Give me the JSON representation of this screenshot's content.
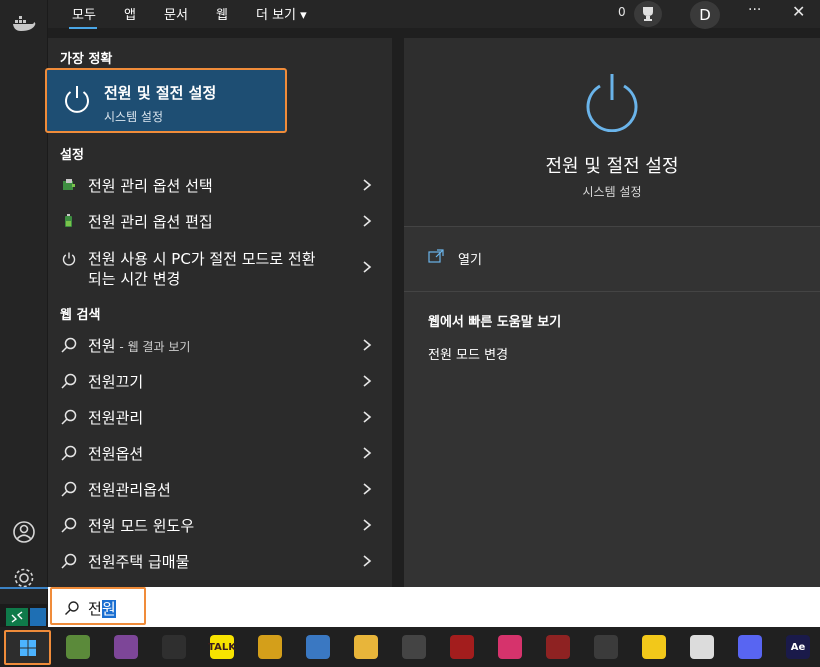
{
  "filter_tabs": [
    "모두",
    "앱",
    "문서",
    "웹",
    "더 보기 ▾"
  ],
  "top_right": {
    "count": "0",
    "avatar": "D",
    "more": "···",
    "close": "✕"
  },
  "sections": {
    "best": "가장 정확",
    "settings": "설정",
    "web": "웹 검색"
  },
  "best_match": {
    "title": "전원 및 절전 설정",
    "subtitle": "시스템 설정"
  },
  "settings_items": [
    {
      "label": "전원 관리 옵션 선택"
    },
    {
      "label": "전원 관리 옵션 편집"
    },
    {
      "label_line1": "전원 사용 시 PC가 절전 모드로 전환",
      "label_line2": "되는 시간 변경"
    }
  ],
  "web_items": [
    {
      "label": "전원",
      "suffix": " - 웹 결과 보기"
    },
    {
      "label": "전원끄기"
    },
    {
      "label": "전원관리"
    },
    {
      "label": "전원옵션"
    },
    {
      "label": "전원관리옵션"
    },
    {
      "label": "전원 모드 윈도우"
    },
    {
      "label": "전원주택 급매물"
    }
  ],
  "preview": {
    "title": "전원 및 절전 설정",
    "subtitle": "시스템 설정",
    "open": "열기",
    "web_title": "웹에서 빠른 도움말 보기",
    "web_link": "전원 모드 변경"
  },
  "search": {
    "typed": "전",
    "selected": "원"
  },
  "taskbar_apps": [
    {
      "name": "minecraft",
      "color": "#5b8a3a",
      "text": ""
    },
    {
      "name": "tor",
      "color": "#7d4698",
      "text": ""
    },
    {
      "name": "obs",
      "color": "#2f2f2f",
      "text": ""
    },
    {
      "name": "kakaotalk",
      "color": "#f7e300",
      "text": "TALK"
    },
    {
      "name": "vscodium-puzzle",
      "color": "#d49f1a",
      "text": ""
    },
    {
      "name": "chrome",
      "color": "#3a78c2",
      "text": ""
    },
    {
      "name": "file-explorer",
      "color": "#e8b53a",
      "text": ""
    },
    {
      "name": "davinci",
      "color": "#444444",
      "text": ""
    },
    {
      "name": "media-player",
      "color": "#a31d1d",
      "text": ""
    },
    {
      "name": "creative-cloud",
      "color": "#d6336c",
      "text": ""
    },
    {
      "name": "winrar",
      "color": "#8e2222",
      "text": ""
    },
    {
      "name": "unity",
      "color": "#3b3b3b",
      "text": ""
    },
    {
      "name": "sticky-notes",
      "color": "#f2c81a",
      "text": ""
    },
    {
      "name": "roblox",
      "color": "#dcdcdc",
      "text": ""
    },
    {
      "name": "discord",
      "color": "#5865f2",
      "text": ""
    },
    {
      "name": "after-effects",
      "color": "#1a1a4a",
      "text": "Ae"
    }
  ]
}
